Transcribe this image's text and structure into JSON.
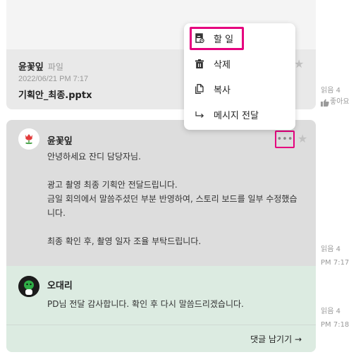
{
  "file_message": {
    "sender": "윤꽃잎",
    "type_label": "파일",
    "date": "2022/06/21 PM 7:17",
    "file_name": "기획안_최종.pptx",
    "read": "읽음 4",
    "like_label": "좋아요"
  },
  "main_message": {
    "sender": "윤꽃잎",
    "body": "안녕하세요 잔디 담당자님.\n\n광고 촬영 최종 기획안 전달드립니다.\n금일 회의에서 말씀주셨던 부분 반영하여, 스토리 보드를 일부 수정했습니다.\n\n최종 확인 후, 촬영 일자 조율 부탁드립니다.",
    "more_label": "•••",
    "read": "읽음 4",
    "time": "PM 7:17"
  },
  "reply": {
    "sender": "오대리",
    "body": "PD님 전달 감사합니다. 확인 후 다시 말씀드리겠습니다.",
    "read": "읽음 4",
    "time": "PM 7:18"
  },
  "comment_button": "댓글 남기기 →",
  "context_menu": {
    "items": [
      {
        "label": "할 일",
        "icon": "todo-icon"
      },
      {
        "label": "삭제",
        "icon": "trash-icon"
      },
      {
        "label": "복사",
        "icon": "copy-icon"
      },
      {
        "label": "메시지 전달",
        "icon": "forward-icon"
      }
    ]
  },
  "colors": {
    "highlight": "#e5007e",
    "reply_bg": "#dcebe1",
    "message_bg": "#dddddd"
  }
}
